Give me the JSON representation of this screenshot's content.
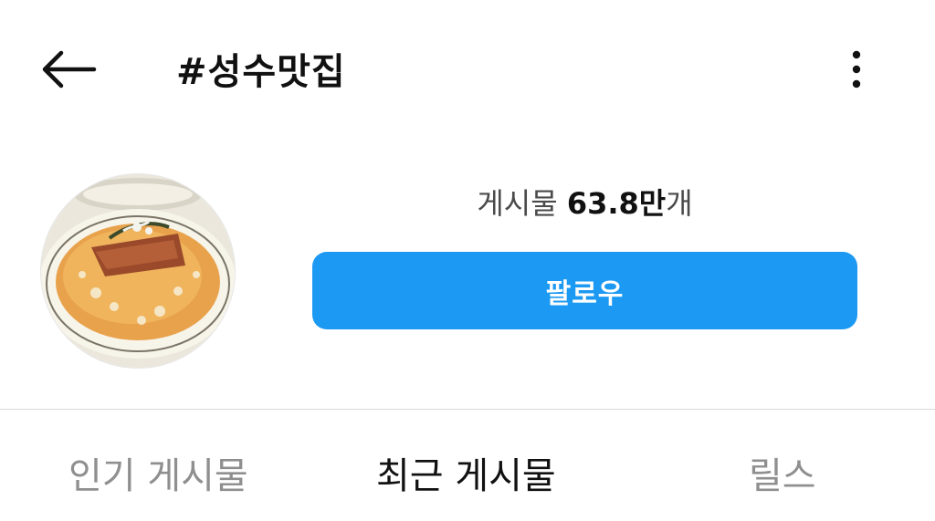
{
  "header": {
    "back_icon": "arrow-left-icon",
    "title": "#성수맛집",
    "menu_icon": "more-vertical-icon"
  },
  "profile": {
    "avatar_alt": "",
    "posts_label": "게시물",
    "posts_count": "63.8만",
    "posts_unit": "개",
    "follow_label": "팔로우",
    "follow_color": "#1C99F2"
  },
  "tabs": [
    {
      "label": "인기 게시물",
      "active": false
    },
    {
      "label": "최근 게시물",
      "active": true
    },
    {
      "label": "릴스",
      "active": false
    }
  ]
}
